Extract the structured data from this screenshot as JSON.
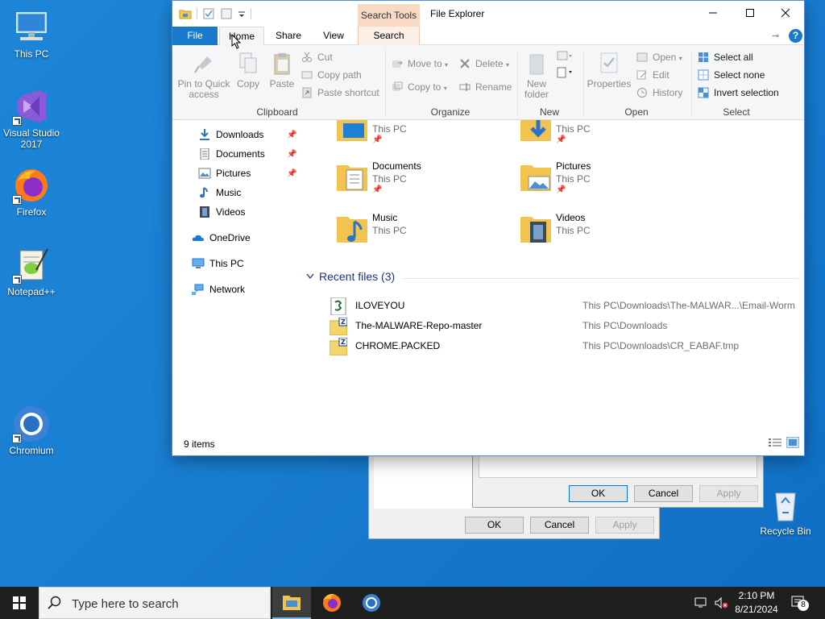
{
  "desktop": {
    "icons": [
      {
        "label": "This PC"
      },
      {
        "label": "Visual Studio\n2017"
      },
      {
        "label": "Firefox"
      },
      {
        "label": "Notepad++"
      },
      {
        "label": "Chromium"
      },
      {
        "label": "Recycle Bin"
      }
    ]
  },
  "bg_dialogs": {
    "front": {
      "ok": "OK",
      "cancel": "Cancel",
      "apply": "Apply"
    },
    "back": {
      "ok": "OK",
      "cancel": "Cancel",
      "apply": "Apply"
    }
  },
  "explorer": {
    "title": "File Explorer",
    "contextual_header": "Search Tools",
    "tabs": {
      "file": "File",
      "home": "Home",
      "share": "Share",
      "view": "View",
      "search": "Search"
    },
    "ribbon": {
      "clipboard": {
        "pin": "Pin to Quick\naccess",
        "copy": "Copy",
        "paste": "Paste",
        "cut": "Cut",
        "copy_path": "Copy path",
        "paste_shortcut": "Paste shortcut",
        "label": "Clipboard"
      },
      "organize": {
        "move_to": "Move to",
        "copy_to": "Copy to",
        "delete": "Delete",
        "rename": "Rename",
        "label": "Organize"
      },
      "new": {
        "new_folder": "New\nfolder",
        "label": "New"
      },
      "open": {
        "properties": "Properties",
        "open": "Open",
        "edit": "Edit",
        "history": "History",
        "label": "Open"
      },
      "select": {
        "select_all": "Select all",
        "select_none": "Select none",
        "invert": "Invert selection",
        "label": "Select"
      }
    },
    "nav": {
      "downloads": "Downloads",
      "documents": "Documents",
      "pictures": "Pictures",
      "music": "Music",
      "videos": "Videos",
      "onedrive": "OneDrive",
      "this_pc": "This PC",
      "network": "Network"
    },
    "folders": [
      {
        "name": "",
        "location": "This PC"
      },
      {
        "name": "",
        "location": "This PC"
      },
      {
        "name": "Documents",
        "location": "This PC"
      },
      {
        "name": "Pictures",
        "location": "This PC"
      },
      {
        "name": "Music",
        "location": "This PC"
      },
      {
        "name": "Videos",
        "location": "This PC"
      }
    ],
    "recent": {
      "header": "Recent files (3)",
      "files": [
        {
          "name": "ILOVEYOU",
          "path": "This PC\\Downloads\\The-MALWAR...\\Email-Worm"
        },
        {
          "name": "The-MALWARE-Repo-master",
          "path": "This PC\\Downloads"
        },
        {
          "name": "CHROME.PACKED",
          "path": "This PC\\Downloads\\CR_EABAF.tmp"
        }
      ]
    },
    "status": {
      "items": "9 items"
    }
  },
  "taskbar": {
    "search_placeholder": "Type here to search",
    "time": "2:10 PM",
    "date": "8/21/2024",
    "notification_count": "8"
  }
}
